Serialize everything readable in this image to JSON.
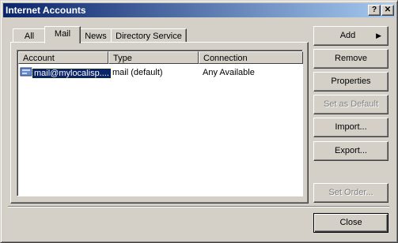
{
  "window": {
    "title": "Internet Accounts"
  },
  "titlebar_buttons": {
    "help": "?",
    "close": "✕"
  },
  "tabs": [
    {
      "label": "All"
    },
    {
      "label": "Mail"
    },
    {
      "label": "News"
    },
    {
      "label": "Directory Service"
    }
  ],
  "list": {
    "columns": [
      "Account",
      "Type",
      "Connection"
    ],
    "rows": [
      {
        "account": "mail@mylocalisp....",
        "type": "mail (default)",
        "connection": "Any Available"
      }
    ]
  },
  "buttons": {
    "add": "Add",
    "remove": "Remove",
    "properties": "Properties",
    "set_default": "Set as Default",
    "import": "Import...",
    "export": "Export...",
    "set_order": "Set Order...",
    "close": "Close"
  },
  "colors": {
    "title_start": "#0a246a",
    "title_end": "#a6caf0",
    "face": "#d4d0c8",
    "selection": "#0a246a"
  },
  "icons": {
    "account_icon": "mail-account-icon",
    "add_arrow": "triangle-right-icon"
  }
}
